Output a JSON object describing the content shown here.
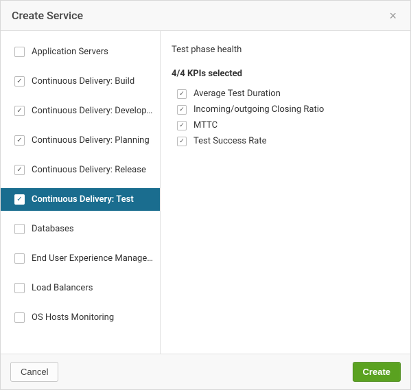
{
  "header": {
    "title": "Create Service"
  },
  "services": [
    {
      "label": "Application Servers",
      "checked": false,
      "selected": false
    },
    {
      "label": "Continuous Delivery: Build",
      "checked": true,
      "selected": false
    },
    {
      "label": "Continuous Delivery: Development",
      "checked": true,
      "selected": false
    },
    {
      "label": "Continuous Delivery: Planning",
      "checked": true,
      "selected": false
    },
    {
      "label": "Continuous Delivery: Release",
      "checked": true,
      "selected": false
    },
    {
      "label": "Continuous Delivery: Test",
      "checked": true,
      "selected": true
    },
    {
      "label": "Databases",
      "checked": false,
      "selected": false
    },
    {
      "label": "End User Experience Manageme…",
      "checked": false,
      "selected": false
    },
    {
      "label": "Load Balancers",
      "checked": false,
      "selected": false
    },
    {
      "label": "OS Hosts Monitoring",
      "checked": false,
      "selected": false
    }
  ],
  "detail": {
    "title": "Test phase health",
    "summary": "4/4 KPIs selected",
    "kpis": [
      {
        "label": "Average Test Duration",
        "checked": true
      },
      {
        "label": "Incoming/outgoing Closing Ratio",
        "checked": true
      },
      {
        "label": "MTTC",
        "checked": true
      },
      {
        "label": "Test Success Rate",
        "checked": true
      }
    ]
  },
  "footer": {
    "cancel_label": "Cancel",
    "create_label": "Create"
  }
}
